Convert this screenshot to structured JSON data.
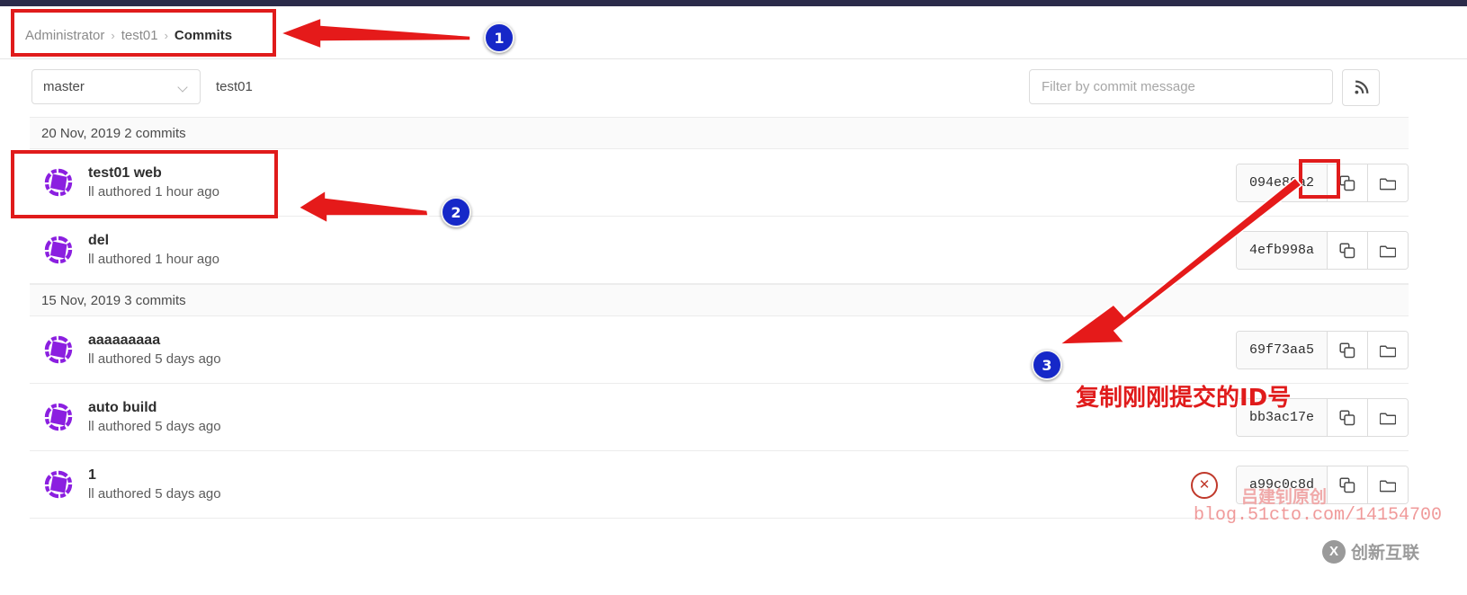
{
  "breadcrumb": {
    "root": "Administrator",
    "project": "test01",
    "current": "Commits",
    "sep": "›"
  },
  "toolbar": {
    "branch": "master",
    "repo_name": "test01",
    "filter_placeholder": "Filter by commit message",
    "filter_value": "",
    "rss_icon": "rss-icon",
    "chevron_icon": "chevron-down-icon"
  },
  "groups": [
    {
      "date_label": "20 Nov, 2019 2 commits",
      "commits": [
        {
          "title": "test01 web",
          "author_line": "ll authored 1 hour ago",
          "sha": "094e89a2",
          "copy_icon": "copy-icon",
          "browse_icon": "folder-icon",
          "status": ""
        },
        {
          "title": "del",
          "author_line": "ll authored 1 hour ago",
          "sha": "4efb998a",
          "copy_icon": "copy-icon",
          "browse_icon": "folder-icon",
          "status": ""
        }
      ]
    },
    {
      "date_label": "15 Nov, 2019 3 commits",
      "commits": [
        {
          "title": "aaaaaaaaa",
          "author_line": "ll authored 5 days ago",
          "sha": "69f73aa5",
          "copy_icon": "copy-icon",
          "browse_icon": "folder-icon",
          "status": ""
        },
        {
          "title": "auto build",
          "author_line": "ll authored 5 days ago",
          "sha": "bb3ac17e",
          "copy_icon": "copy-icon",
          "browse_icon": "folder-icon",
          "status": ""
        },
        {
          "title": "1",
          "author_line": "ll authored 5 days ago",
          "sha": "a99c0c8d",
          "copy_icon": "copy-icon",
          "browse_icon": "folder-icon",
          "status": "failed"
        }
      ]
    }
  ],
  "annotations": {
    "marker1": "1",
    "marker2": "2",
    "marker3": "3",
    "note3": "复制刚刚提交的ID号",
    "accent_red": "#e01b1b",
    "marker_blue": "#1628c8"
  },
  "watermarks": {
    "author": "吕建钊原创",
    "blog": "blog.51cto.com/14154700",
    "brand": "创新互联",
    "brand_mark": "X"
  }
}
